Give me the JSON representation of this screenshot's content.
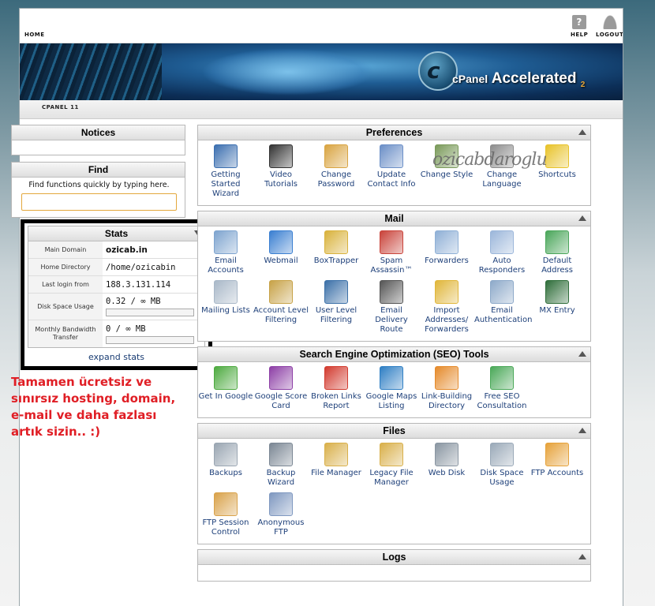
{
  "topbar": {
    "home_label": "HOME",
    "help_label": "HELP",
    "logout_label": "LOGOUT"
  },
  "banner": {
    "logo_letter": "c",
    "brand": "cPanel",
    "product": "Accelerated",
    "version": "2"
  },
  "subbar": {
    "label": "CPANEL 11"
  },
  "left": {
    "notices_title": "Notices",
    "find_title": "Find",
    "find_hint": "Find functions quickly by typing here.",
    "find_value": "",
    "stats_title": "Stats",
    "stats": [
      {
        "label": "Main Domain",
        "value": "ozicab.in"
      },
      {
        "label": "Home Directory",
        "value": "/home/ozicabin"
      },
      {
        "label": "Last login from",
        "value": "188.3.131.114"
      },
      {
        "label": "Disk Space Usage",
        "value": "0.32 / ∞ MB",
        "fraction": 0
      },
      {
        "label": "Monthly Bandwidth Transfer",
        "value": "0 / ∞ MB",
        "fraction": 0
      }
    ],
    "expand_label": "expand stats"
  },
  "promo_lines": [
    "Tamamen ücretsiz ve",
    "sınırsız hosting, domain,",
    "e-mail ve daha fazlası",
    "artık sizin.. :)"
  ],
  "watermark": "ozicabdaroglu",
  "groups": [
    {
      "title": "Preferences",
      "items": [
        {
          "label": "Getting Started Wizard",
          "icon": "wizard-icon",
          "color": "#3b6fb0"
        },
        {
          "label": "Video Tutorials",
          "icon": "video-icon",
          "color": "#333333"
        },
        {
          "label": "Change Password",
          "icon": "password-icon",
          "color": "#d9a441"
        },
        {
          "label": "Update Contact Info",
          "icon": "contact-icon",
          "color": "#6b8fc7"
        },
        {
          "label": "Change Style",
          "icon": "style-icon",
          "color": "#7a9a5a"
        },
        {
          "label": "Change Language",
          "icon": "language-icon",
          "color": "#8e8e8e"
        },
        {
          "label": "Shortcuts",
          "icon": "star-icon",
          "color": "#e8c32a"
        }
      ]
    },
    {
      "title": "Mail",
      "items": [
        {
          "label": "Email Accounts",
          "icon": "email-accounts-icon",
          "color": "#7ea4cf"
        },
        {
          "label": "Webmail",
          "icon": "webmail-icon",
          "color": "#3a7fd1"
        },
        {
          "label": "BoxTrapper",
          "icon": "boxtrapper-icon",
          "color": "#d9b23c"
        },
        {
          "label": "Spam Assassin™",
          "icon": "spam-icon",
          "color": "#c9433a"
        },
        {
          "label": "Forwarders",
          "icon": "forwarders-icon",
          "color": "#8fb0d6"
        },
        {
          "label": "Auto Responders",
          "icon": "autoresponder-icon",
          "color": "#9bb6da"
        },
        {
          "label": "Default Address",
          "icon": "default-address-icon",
          "color": "#4aa65a"
        },
        {
          "label": "Mailing Lists",
          "icon": "mailing-lists-icon",
          "color": "#a9b8c8"
        },
        {
          "label": "Account Level Filtering",
          "icon": "filter-icon",
          "color": "#c7a247"
        },
        {
          "label": "User Level Filtering",
          "icon": "user-filter-icon",
          "color": "#3b70a8"
        },
        {
          "label": "Email Delivery Route",
          "icon": "delivery-icon",
          "color": "#555555"
        },
        {
          "label": "Import Addresses/ Forwarders",
          "icon": "import-icon",
          "color": "#e0b63a"
        },
        {
          "label": "Email Authentication",
          "icon": "auth-icon",
          "color": "#8da9c9"
        },
        {
          "label": "MX Entry",
          "icon": "mx-icon",
          "color": "#2f6e3a"
        }
      ]
    },
    {
      "title": "Search Engine Optimization (SEO) Tools",
      "items": [
        {
          "label": "Get In Google",
          "icon": "get-in-google-icon",
          "color": "#4daa3f"
        },
        {
          "label": "Google Score Card",
          "icon": "scorecard-icon",
          "color": "#8d3fa6"
        },
        {
          "label": "Broken Links Report",
          "icon": "broken-links-icon",
          "color": "#d23a2e"
        },
        {
          "label": "Google Maps Listing",
          "icon": "maps-icon",
          "color": "#2f7fc4"
        },
        {
          "label": "Link-Building Directory",
          "icon": "link-building-icon",
          "color": "#e58a2a"
        },
        {
          "label": "Free SEO Consultation",
          "icon": "consultation-icon",
          "color": "#4aa858"
        }
      ]
    },
    {
      "title": "Files",
      "items": [
        {
          "label": "Backups",
          "icon": "backups-icon",
          "color": "#9aa6b2"
        },
        {
          "label": "Backup Wizard",
          "icon": "backup-wizard-icon",
          "color": "#7b8794"
        },
        {
          "label": "File Manager",
          "icon": "file-manager-icon",
          "color": "#d9b04a"
        },
        {
          "label": "Legacy File Manager",
          "icon": "legacy-file-manager-icon",
          "color": "#d9b04a"
        },
        {
          "label": "Web Disk",
          "icon": "web-disk-icon",
          "color": "#8a96a2"
        },
        {
          "label": "Disk Space Usage",
          "icon": "disk-usage-icon",
          "color": "#9aa9b8"
        },
        {
          "label": "FTP Accounts",
          "icon": "ftp-accounts-icon",
          "color": "#e6a23a"
        },
        {
          "label": "FTP Session Control",
          "icon": "ftp-session-icon",
          "color": "#d9a24a"
        },
        {
          "label": "Anonymous FTP",
          "icon": "anonymous-ftp-icon",
          "color": "#7f98c0"
        }
      ]
    },
    {
      "title": "Logs",
      "items": []
    }
  ]
}
